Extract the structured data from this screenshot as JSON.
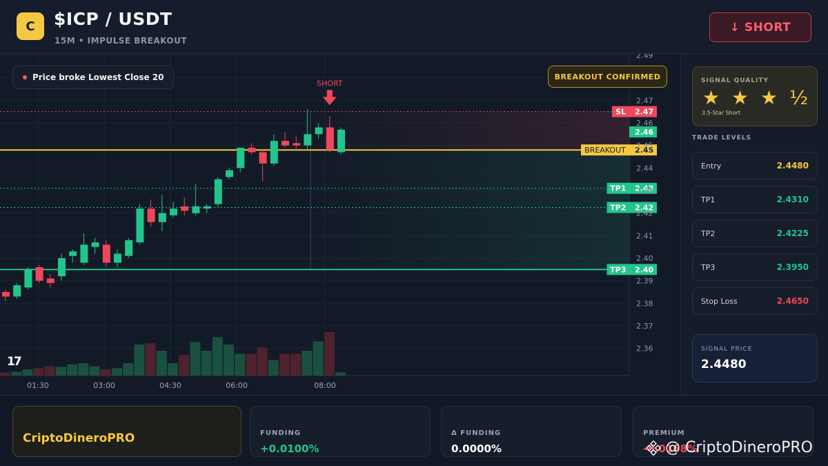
{
  "header": {
    "logo_letter": "C",
    "pair": "$ICP / USDT",
    "subtitle": "15M • IMPULSE BREAKOUT",
    "short_button": "↓ SHORT"
  },
  "chart_overlay": {
    "breakout_note": "Price broke Lowest Close 20",
    "confirm_badge": "BREAKOUT CONFIRMED",
    "short_marker": "SHORT",
    "tv_logo": "17"
  },
  "chart_data": {
    "type": "candlestick",
    "ylim": [
      2.355,
      2.49
    ],
    "y_ticks": [
      "2.49",
      "2.48",
      "2.47",
      "2.46",
      "2.45",
      "2.44",
      "2.43",
      "2.42",
      "2.41",
      "2.40",
      "2.39",
      "2.38",
      "2.37",
      "2.36"
    ],
    "x_ticks": [
      "01:30",
      "03:00",
      "04:30",
      "06:00",
      "08:00"
    ],
    "colors": {
      "up": "#22c58b",
      "down": "#f0475b",
      "breakout": "#f5c842",
      "sl": "#f0475b",
      "tp": "#22c58b"
    },
    "candles": [
      {
        "o": 2.385,
        "h": 2.386,
        "l": 2.381,
        "c": 2.383
      },
      {
        "o": 2.383,
        "h": 2.389,
        "l": 2.382,
        "c": 2.388
      },
      {
        "o": 2.387,
        "h": 2.396,
        "l": 2.386,
        "c": 2.395
      },
      {
        "o": 2.396,
        "h": 2.397,
        "l": 2.389,
        "c": 2.39
      },
      {
        "o": 2.391,
        "h": 2.393,
        "l": 2.387,
        "c": 2.389
      },
      {
        "o": 2.392,
        "h": 2.402,
        "l": 2.39,
        "c": 2.4
      },
      {
        "o": 2.401,
        "h": 2.404,
        "l": 2.398,
        "c": 2.403
      },
      {
        "o": 2.398,
        "h": 2.411,
        "l": 2.397,
        "c": 2.406
      },
      {
        "o": 2.405,
        "h": 2.409,
        "l": 2.402,
        "c": 2.407
      },
      {
        "o": 2.406,
        "h": 2.408,
        "l": 2.396,
        "c": 2.398
      },
      {
        "o": 2.398,
        "h": 2.404,
        "l": 2.396,
        "c": 2.402
      },
      {
        "o": 2.401,
        "h": 2.409,
        "l": 2.4,
        "c": 2.408
      },
      {
        "o": 2.407,
        "h": 2.424,
        "l": 2.406,
        "c": 2.422
      },
      {
        "o": 2.422,
        "h": 2.426,
        "l": 2.414,
        "c": 2.416
      },
      {
        "o": 2.416,
        "h": 2.428,
        "l": 2.412,
        "c": 2.42
      },
      {
        "o": 2.419,
        "h": 2.425,
        "l": 2.418,
        "c": 2.422
      },
      {
        "o": 2.423,
        "h": 2.427,
        "l": 2.419,
        "c": 2.421
      },
      {
        "o": 2.42,
        "h": 2.433,
        "l": 2.419,
        "c": 2.423
      },
      {
        "o": 2.422,
        "h": 2.424,
        "l": 2.42,
        "c": 2.423
      },
      {
        "o": 2.424,
        "h": 2.436,
        "l": 2.423,
        "c": 2.435
      },
      {
        "o": 2.436,
        "h": 2.44,
        "l": 2.435,
        "c": 2.439
      },
      {
        "o": 2.44,
        "h": 2.449,
        "l": 2.438,
        "c": 2.449
      },
      {
        "o": 2.449,
        "h": 2.451,
        "l": 2.446,
        "c": 2.447
      },
      {
        "o": 2.447,
        "h": 2.448,
        "l": 2.434,
        "c": 2.442
      },
      {
        "o": 2.442,
        "h": 2.455,
        "l": 2.441,
        "c": 2.452
      },
      {
        "o": 2.452,
        "h": 2.456,
        "l": 2.449,
        "c": 2.45
      },
      {
        "o": 2.451,
        "h": 2.454,
        "l": 2.448,
        "c": 2.45
      },
      {
        "o": 2.45,
        "h": 2.466,
        "l": 2.448,
        "c": 2.455
      },
      {
        "o": 2.455,
        "h": 2.46,
        "l": 2.453,
        "c": 2.458
      },
      {
        "o": 2.458,
        "h": 2.463,
        "l": 2.447,
        "c": 2.448
      },
      {
        "o": 2.447,
        "h": 2.458,
        "l": 2.446,
        "c": 2.457
      }
    ],
    "volume_max": 100,
    "volumes": [
      5,
      6,
      10,
      12,
      15,
      14,
      18,
      20,
      15,
      10,
      12,
      20,
      50,
      52,
      40,
      20,
      33,
      54,
      40,
      62,
      50,
      35,
      35,
      45,
      25,
      35,
      35,
      40,
      55,
      70,
      5
    ],
    "levels": [
      {
        "label": "SL",
        "value": 2.465,
        "text": "2.47",
        "kind": "sl"
      },
      {
        "label": "",
        "value": 2.456,
        "text": "2.46",
        "kind": "price"
      },
      {
        "label": "BREAKOUT",
        "value": 2.448,
        "text": "2.45",
        "kind": "breakout"
      },
      {
        "label": "TP1",
        "value": 2.431,
        "text": "2.43",
        "kind": "tp"
      },
      {
        "label": "TP2",
        "value": 2.4225,
        "text": "2.42",
        "kind": "tp"
      },
      {
        "label": "TP3",
        "value": 2.395,
        "text": "2.40",
        "kind": "tp"
      }
    ]
  },
  "sidebar": {
    "signal_quality_label": "SIGNAL QUALITY",
    "stars": "★ ★ ★ ½",
    "stars_value": 3.5,
    "stars_note": "3.5-Star Short",
    "trade_levels_title": "TRADE LEVELS",
    "levels": [
      {
        "label": "Entry",
        "value": "2.4480",
        "color": "#f5c842"
      },
      {
        "label": "TP1",
        "value": "2.4310",
        "color": "#22c58b"
      },
      {
        "label": "TP2",
        "value": "2.4225",
        "color": "#22c58b"
      },
      {
        "label": "TP3",
        "value": "2.3950",
        "color": "#22c58b"
      },
      {
        "label": "Stop Loss",
        "value": "2.4650",
        "color": "#f0475b"
      }
    ],
    "signal_price_label": "SIGNAL PRICE",
    "signal_price": "2.4480"
  },
  "bottom": {
    "brand": "CriptoDineroPRO",
    "stats": [
      {
        "label": "FUNDING",
        "value": "+0.0100%",
        "color": "#22c58b"
      },
      {
        "label": "Δ FUNDING",
        "value": "0.0000%",
        "color": "#ffffff"
      },
      {
        "label": "PREMIUM",
        "value": "-0.0168%",
        "color": "#f0475b"
      }
    ],
    "watermark": "@ CriptoDineroPRO"
  }
}
